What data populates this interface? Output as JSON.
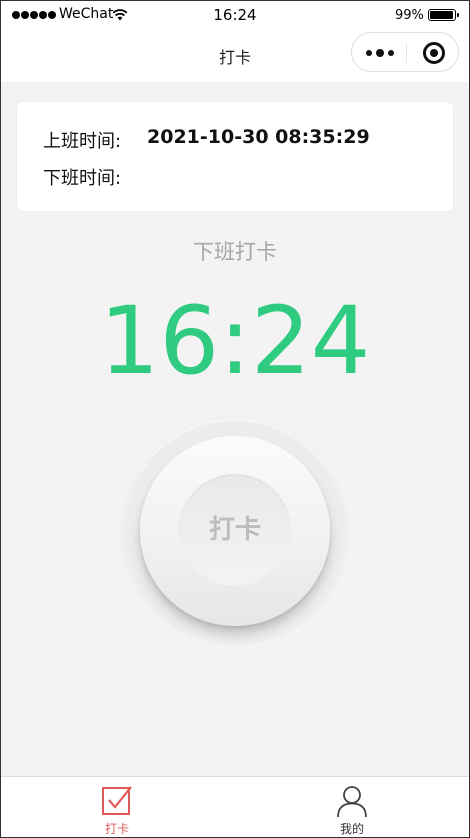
{
  "status_bar": {
    "carrier": "WeChat",
    "time": "16:24",
    "battery": "99%"
  },
  "nav": {
    "title": "打卡"
  },
  "record": {
    "on_duty_label": "上班时间:",
    "on_duty_value": "2021-10-30 08:35:29",
    "off_duty_label": "下班时间:",
    "off_duty_value": ""
  },
  "main": {
    "status_label": "下班打卡",
    "current_time": "16:24",
    "punch_button_label": "打卡"
  },
  "tabbar": {
    "items": [
      {
        "label": "打卡",
        "icon": "checkbox-icon",
        "active": true,
        "color": "#e05a5a"
      },
      {
        "label": "我的",
        "icon": "user-icon",
        "active": false,
        "color": "#333333"
      }
    ]
  },
  "colors": {
    "accent_green": "#2ecb81",
    "active_tab": "#e05a5a"
  }
}
